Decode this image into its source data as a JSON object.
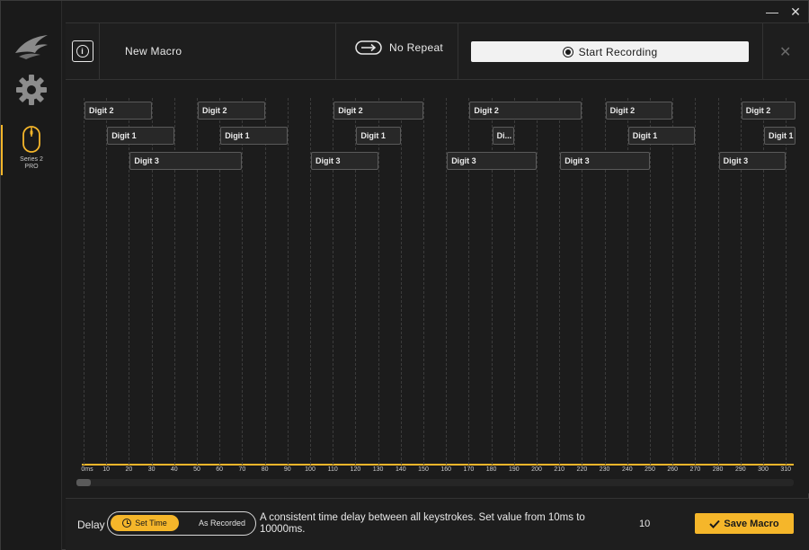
{
  "window": {
    "minimize_glyph": "—",
    "close_glyph": "✕"
  },
  "sidebar": {
    "logo_icon": "brand-wing-icon",
    "settings_icon": "gear-icon",
    "device_label": "Series 2\nPRO",
    "accent": "#f5b62a"
  },
  "header": {
    "info_glyph": "i",
    "macro_name": "New Macro",
    "repeat_label": "No Repeat",
    "record_label": "Start Recording",
    "close_glyph": "✕"
  },
  "timeline": {
    "ticks": [
      "0ms",
      "10",
      "20",
      "30",
      "40",
      "50",
      "60",
      "70",
      "80",
      "90",
      "100",
      "110",
      "120",
      "130",
      "140",
      "150",
      "160",
      "170",
      "180",
      "190",
      "200",
      "210",
      "220",
      "230",
      "240",
      "250",
      "260",
      "270",
      "280",
      "290",
      "300",
      "310"
    ],
    "events": [
      {
        "label": "Digit 2",
        "lane": 0,
        "start": 0,
        "end": 30
      },
      {
        "label": "Digit 1",
        "lane": 1,
        "start": 10,
        "end": 40
      },
      {
        "label": "Digit 3",
        "lane": 2,
        "start": 20,
        "end": 70
      },
      {
        "label": "Digit 2",
        "lane": 0,
        "start": 50,
        "end": 80
      },
      {
        "label": "Digit 1",
        "lane": 1,
        "start": 60,
        "end": 90
      },
      {
        "label": "Digit 3",
        "lane": 2,
        "start": 100,
        "end": 130
      },
      {
        "label": "Digit 2",
        "lane": 0,
        "start": 110,
        "end": 150
      },
      {
        "label": "Digit 1",
        "lane": 1,
        "start": 120,
        "end": 140
      },
      {
        "label": "Digit 3",
        "lane": 2,
        "start": 160,
        "end": 200
      },
      {
        "label": "Digit 2",
        "lane": 0,
        "start": 170,
        "end": 220
      },
      {
        "label": "Di...",
        "lane": 1,
        "start": 180,
        "end": 190
      },
      {
        "label": "Digit 3",
        "lane": 2,
        "start": 210,
        "end": 250
      },
      {
        "label": "Digit 2",
        "lane": 0,
        "start": 230,
        "end": 260
      },
      {
        "label": "Digit 1",
        "lane": 1,
        "start": 240,
        "end": 270
      },
      {
        "label": "Digit 3",
        "lane": 2,
        "start": 280,
        "end": 310
      },
      {
        "label": "Digit 2",
        "lane": 0,
        "start": 290,
        "end": 320
      },
      {
        "label": "Digit 1",
        "lane": 1,
        "start": 300,
        "end": 320
      }
    ]
  },
  "footer": {
    "delay_label": "Delay",
    "set_time_label": "Set Time",
    "as_recorded_label": "As Recorded",
    "description": "A consistent time delay between all keystrokes. Set value from 10ms to 10000ms.",
    "delay_value": "10",
    "save_label": "Save Macro"
  }
}
